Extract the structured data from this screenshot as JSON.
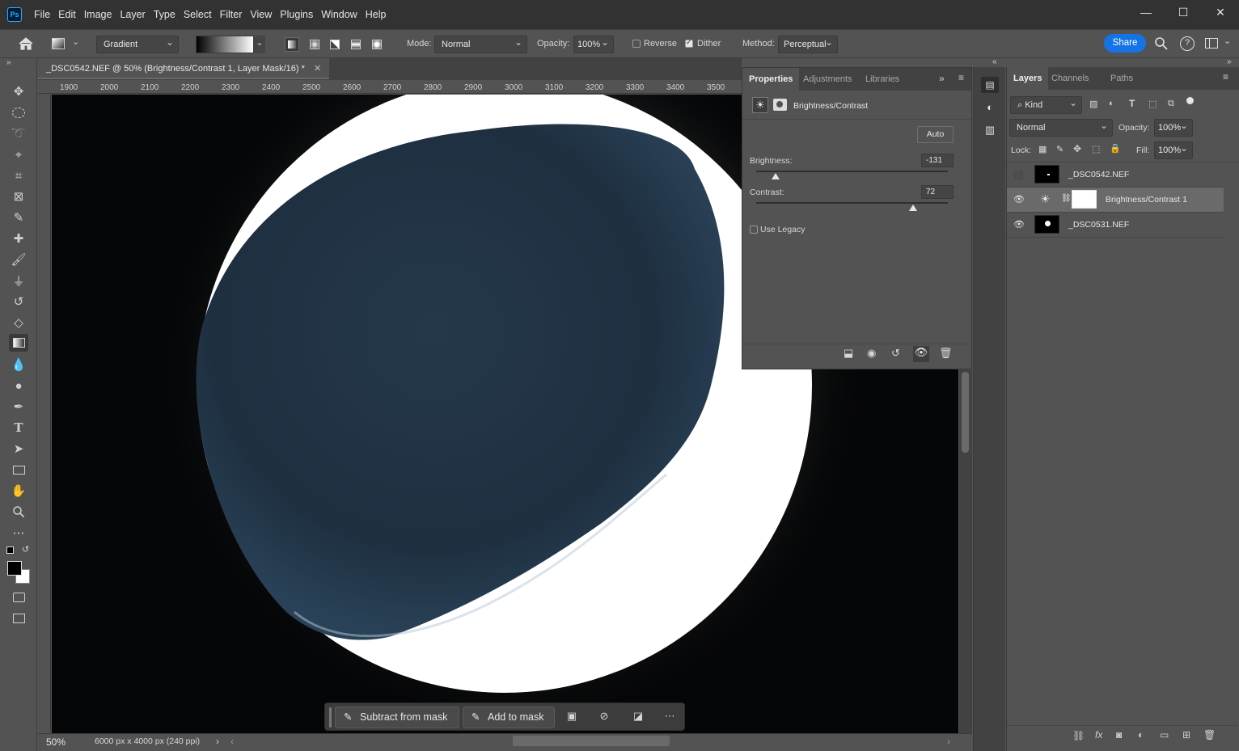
{
  "menu": {
    "logo": "Ps",
    "items": [
      "File",
      "Edit",
      "Image",
      "Layer",
      "Type",
      "Select",
      "Filter",
      "View",
      "Plugins",
      "Window",
      "Help"
    ]
  },
  "window_controls": {
    "minimize": "—",
    "maximize": "☐",
    "close": "✕"
  },
  "options": {
    "preset": "Gradient",
    "mode_label": "Mode:",
    "mode_value": "Normal",
    "opacity_label": "Opacity:",
    "opacity_value": "100%",
    "reverse_label": "Reverse",
    "reverse_checked": false,
    "dither_label": "Dither",
    "dither_checked": true,
    "method_label": "Method:",
    "method_value": "Perceptual",
    "share_label": "Share"
  },
  "document": {
    "tab_title": "_DSC0542.NEF @ 50% (Brightness/Contrast 1, Layer Mask/16) *",
    "ruler_ticks": [
      "1900",
      "2000",
      "2100",
      "2200",
      "2300",
      "2400",
      "2500",
      "2600",
      "2700",
      "2800",
      "2900",
      "3000",
      "3100",
      "3200",
      "3300",
      "3400",
      "3500"
    ],
    "zoom": "50%",
    "doc_info": "6000 px x 4000 px (240 ppi)"
  },
  "context_bar": {
    "subtract_label": "Subtract from mask",
    "add_label": "Add to mask"
  },
  "properties": {
    "tabs": [
      "Properties",
      "Adjustments",
      "Libraries"
    ],
    "adjustment_name": "Brightness/Contrast",
    "auto_label": "Auto",
    "brightness_label": "Brightness:",
    "brightness_value": "-131",
    "brightness_level": 0.1,
    "contrast_label": "Contrast:",
    "contrast_value": "72",
    "contrast_level": 0.82,
    "use_legacy_label": "Use Legacy",
    "use_legacy_checked": false
  },
  "layers_panel": {
    "tabs": [
      "Layers",
      "Channels",
      "Paths"
    ],
    "filter_kind": "Kind",
    "blend_mode": "Normal",
    "opacity_label": "Opacity:",
    "opacity_value": "100%",
    "lock_label": "Lock:",
    "fill_label": "Fill:",
    "fill_value": "100%",
    "layers": [
      {
        "name": "_DSC0542.NEF",
        "visible": false,
        "selected": false
      },
      {
        "name": "Brightness/Contrast 1",
        "visible": true,
        "selected": true
      },
      {
        "name": "_DSC0531.NEF",
        "visible": true,
        "selected": false
      }
    ]
  },
  "colors": {
    "accent": "#1473e6",
    "panel_bg": "#535353",
    "menubar_bg": "#323232",
    "canvas_bg": "#050607"
  }
}
